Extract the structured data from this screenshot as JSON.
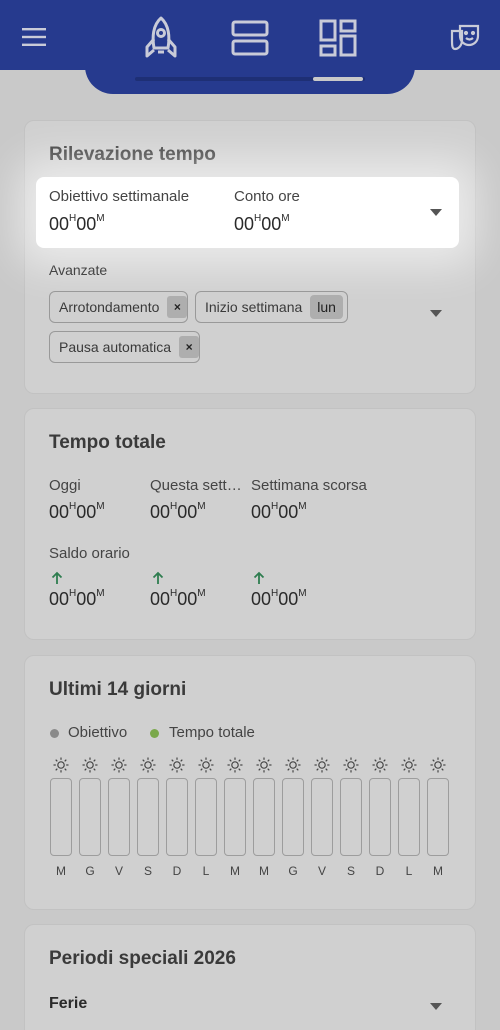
{
  "colors": {
    "appbar": "#263a8e",
    "arrow_up": "#2e7d4f",
    "legend_objective": "#8a8a8a",
    "legend_total": "#7aa84a"
  },
  "icons": [
    "menu-icon",
    "rocket-icon",
    "rows-icon",
    "dashboard-icon",
    "theater-masks-icon"
  ],
  "time_tracking": {
    "title": "Rilevazione tempo",
    "weekly_goal_label": "Obiettivo settimanale",
    "weekly_goal": {
      "h": "00",
      "hu": "H",
      "m": "00",
      "mu": "M"
    },
    "hours_account_label": "Conto ore",
    "hours_account": {
      "h": "00",
      "hu": "H",
      "m": "00",
      "mu": "M"
    },
    "advanced_label": "Avanzate",
    "chips": {
      "rounding": "Arrotondamento",
      "week_start": "Inizio settimana",
      "week_start_value": "lun",
      "auto_pause": "Pausa automatica",
      "remove": "×"
    }
  },
  "total_time": {
    "title": "Tempo totale",
    "today_label": "Oggi",
    "this_week_label": "Questa sett…",
    "last_week_label": "Settimana scorsa",
    "balance_label": "Saldo orario",
    "time": {
      "h": "00",
      "hu": "H",
      "m": "00",
      "mu": "M"
    }
  },
  "last_14_days": {
    "title": "Ultimi 14 giorni",
    "legend_objective": "Obiettivo",
    "legend_total": "Tempo totale",
    "days": [
      "M",
      "G",
      "V",
      "S",
      "D",
      "L",
      "M",
      "M",
      "G",
      "V",
      "S",
      "D",
      "L",
      "M"
    ]
  },
  "special_periods": {
    "title": "Periodi speciali 2026",
    "first_item": "Ferie"
  }
}
